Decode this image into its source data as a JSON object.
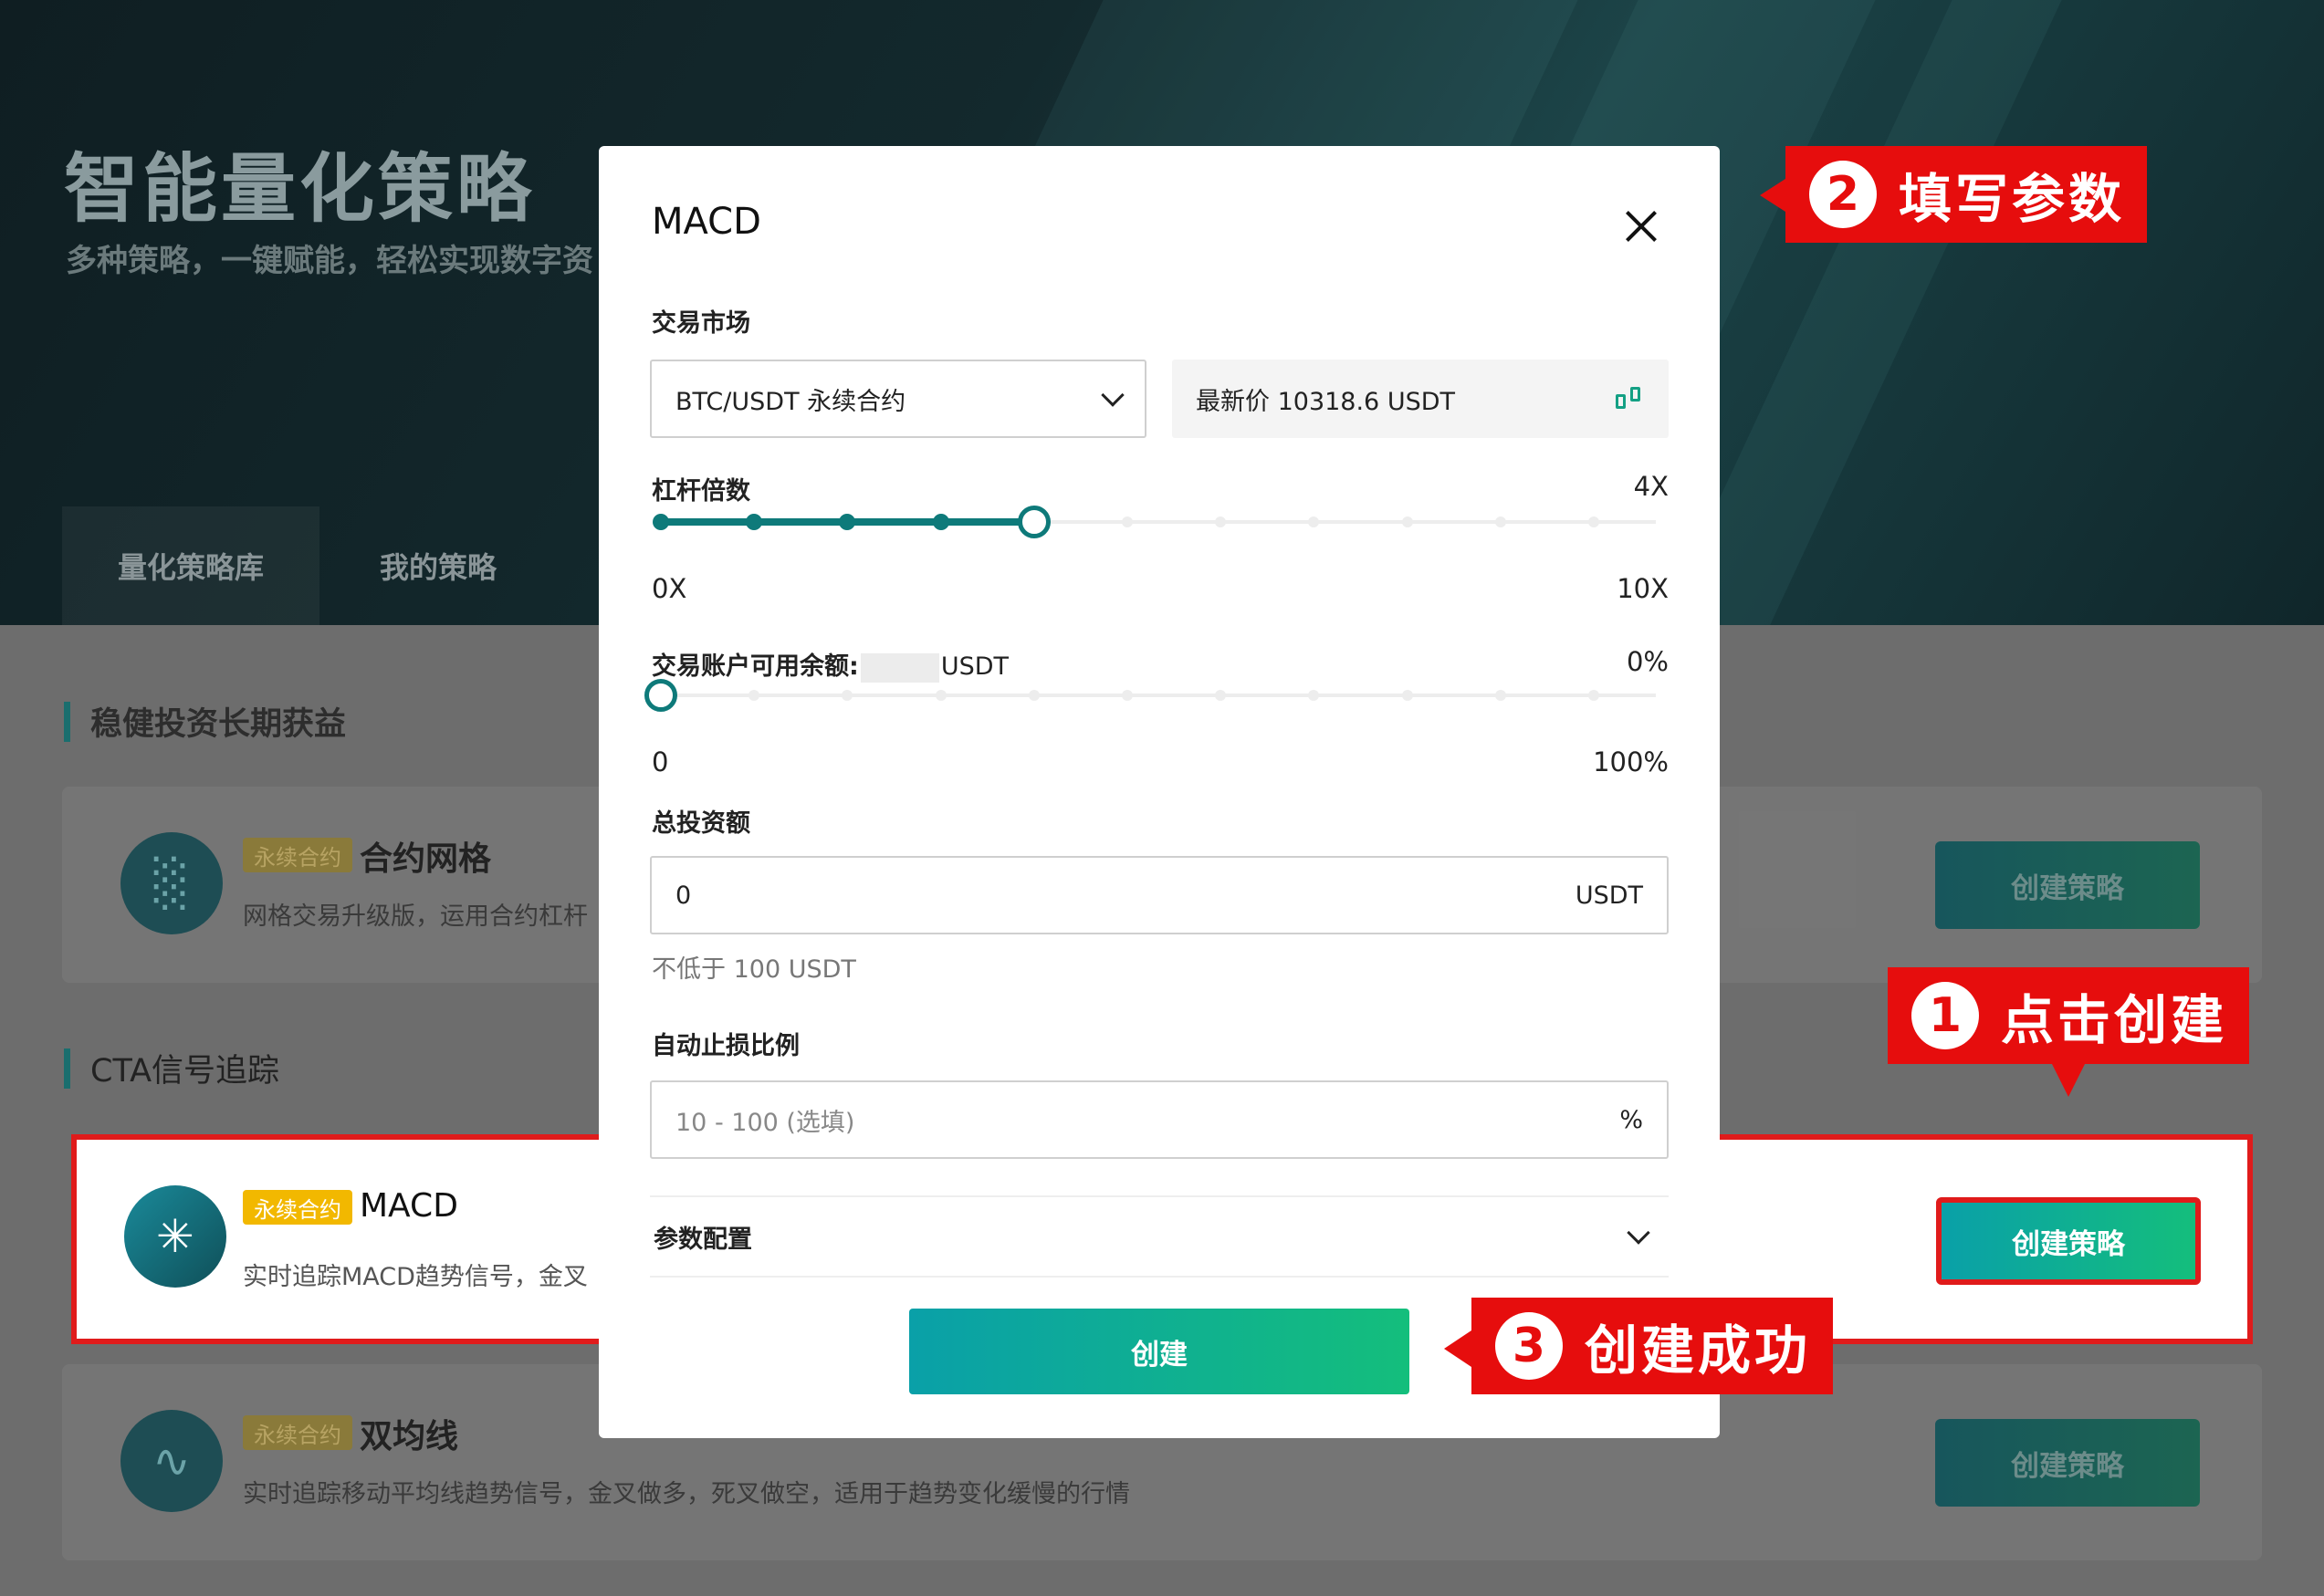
{
  "hero": {
    "title": "智能量化策略",
    "subtitle": "多种策略，一键赋能，轻松实现数字资"
  },
  "tabs": [
    {
      "label": "量化策略库"
    },
    {
      "label": "我的策略"
    }
  ],
  "sections": [
    {
      "title": "稳健投资长期获益"
    },
    {
      "title": "CTA信号追踪"
    }
  ],
  "cards": [
    {
      "badge": "永续合约",
      "name": "合约网格",
      "desc": "网格交易升级版，运用合约杠杆",
      "button": "创建策略",
      "icon": "bar-chart-icon"
    },
    {
      "badge": "永续合约",
      "name": "MACD",
      "desc": "实时追踪MACD趋势信号，金叉",
      "button": "创建策略",
      "icon": "signal-icon"
    },
    {
      "badge": "永续合约",
      "name": "双均线",
      "desc": "实时追踪移动平均线趋势信号，金叉做多，死叉做空，适用于趋势变化缓慢的行情",
      "button": "创建策略",
      "icon": "wave-icon"
    }
  ],
  "modal": {
    "title": "MACD",
    "market_label": "交易市场",
    "market_value": "BTC/USDT 永续合约",
    "price_text": "最新价 10318.6 USDT",
    "leverage_label": "杠杆倍数",
    "leverage_value": "4X",
    "leverage_min": "0X",
    "leverage_max": "10X",
    "leverage_level": 0.4,
    "balance_label": "交易账户可用余额:",
    "balance_unit": "USDT",
    "balance_percent": "0%",
    "balance_min": "0",
    "balance_max": "100%",
    "invest_label": "总投资额",
    "invest_value": "0",
    "invest_unit": "USDT",
    "invest_hint": "不低于 100 USDT",
    "stoploss_label": "自动止损比例",
    "stoploss_placeholder": "10 - 100 (选填)",
    "stoploss_unit": "%",
    "params_label": "参数配置",
    "submit_label": "创建"
  },
  "callouts": {
    "step1": {
      "num": "1",
      "text": "点击创建"
    },
    "step2": {
      "num": "2",
      "text": "填写参数"
    },
    "step3": {
      "num": "3",
      "text": "创建成功"
    }
  },
  "colors": {
    "accent": "#0e7a7a",
    "callout": "#e60d0d",
    "badge": "#f2b800"
  }
}
